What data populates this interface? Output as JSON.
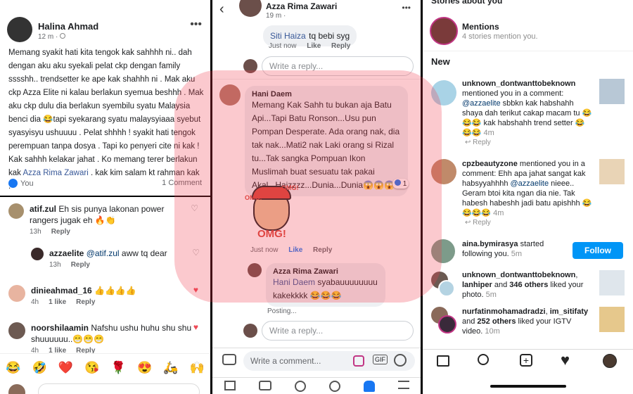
{
  "panel1": {
    "post": {
      "author": "Halina Ahmad",
      "time": "12 m",
      "body": "Memang syakit hati kita tengok kak sahhhh ni.. dah dengan aku aku syekali pelat ckp dengan family sssshh.. trendsetter ke ape kak shahhh ni . Mak aku ckp Azza Elite ni kalau berlakun syemua beshhh . Mak aku ckp dulu dia berlakun syembilu syatu Malaysia benci dia 😂tapi syekarang syatu malaysyiaaa syebut syasyisyu ushuuuu . Pelat shhhh ! syakit hati tengok perempuan tanpa dosya . Tapi ko penyeri cite ni kak ! Kak sahhh kelakar jahat . Ko memang terer berlakun kak",
      "mention": "Azza Rima Zawari",
      "body_end": ". kak kim salam kt rahman kak .",
      "reactors": "You",
      "comment_count": "1 Comment"
    },
    "comments": [
      {
        "name": "atif.zul",
        "text": "Eh sis punya lakonan power rangers jugak eh 🔥👏",
        "time": "13h",
        "reply": "Reply",
        "likes": ""
      },
      {
        "name": "azzaelite",
        "mention": "@atif.zul",
        "text": "aww tq dear",
        "time": "13h",
        "reply": "Reply",
        "likes": ""
      },
      {
        "name": "dinieahmad_16",
        "text": "👍👍👍👍",
        "time": "4h",
        "reply": "Reply",
        "likes": "1 like"
      },
      {
        "name": "noorshilaamin",
        "text": "Nafshu ushu huhu shu shu shuuuuuu..😁😁😁",
        "time": "4h",
        "reply": "Reply",
        "likes": "1 like"
      }
    ],
    "emoji_bar": [
      "😂",
      "🤣",
      "❤️",
      "😘",
      "🌹",
      "😍",
      "🛵",
      "🙌"
    ]
  },
  "panel2": {
    "header": {
      "name": "Azza Rima Zawari",
      "time": "19 m ·"
    },
    "top_reply": {
      "name": "Siti Haiza",
      "text": "tq bebi syg",
      "time": "Just now",
      "like": "Like",
      "reply": "Reply"
    },
    "reply_placeholder": "Write a reply...",
    "comment": {
      "name": "Hani Daem",
      "text": "Memang Kak Sahh tu bukan aja Batu Api...Tapi Batu Ronson...Usu pun Pompan Desperate. Ada orang nak, dia tak nak...Mati2 nak Laki orang si Rizal tu...Tak sangka Pompuan Ikon Muslimah buat sesuatu tak pakai Akal...Haizzzz...Dunia...Dunia😱😱😱",
      "reaction_count": "1",
      "sticker_text": "OMG!",
      "time": "Just now",
      "like": "Like",
      "reply": "Reply"
    },
    "nested_reply": {
      "name": "Azza Rima Zawari",
      "mention": "Hani Daem",
      "text": "syabauuuuuuuu kakekkkk 😂😂😂",
      "status": "Posting..."
    },
    "reply_placeholder2": "Write a reply...",
    "comment_placeholder": "Write a comment...",
    "gif": "GIF"
  },
  "panel3": {
    "stories_header": "Stories about you",
    "mentions_title": "Mentions",
    "mentions_sub": "4 stories mention you.",
    "section_new": "New",
    "activities": [
      {
        "user": "unknown_dontwanttobeknown",
        "text": "mentioned you in a comment:",
        "mention": "@azzaelite",
        "text2": "sbbkn kak habshahh shaya dah terikut cakap macam tu 😂😂😂 kak habshahh trend setter 😂😂😂",
        "time": "4m",
        "reply": "Reply"
      },
      {
        "user": "cpzbeautyzone",
        "text": "mentioned you in a comment: Ehh apa jahat sangat kak habsyyahhhh",
        "mention": "@azzaelite",
        "text2": "nieee.. Geram btoi kita ngan dia nie. Tak habesh habeshh jadi batu apishhh 😂😂😂😂",
        "time": "4m",
        "reply": "Reply"
      },
      {
        "user": "aina.bymirasya",
        "text": "started following you.",
        "time": "5m",
        "button": "Follow"
      },
      {
        "user": "unknown_dontwanttobeknown",
        "text": ",",
        "user2": "lanhiper",
        "text2": "and",
        "count": "346 others",
        "text3": "liked your photo.",
        "time": "5m"
      },
      {
        "user": "nurfatinmohamadradzi",
        "text": ",",
        "user2": "im_sitifaty",
        "text2": "and",
        "count": "252 others",
        "text3": "liked your IGTV video.",
        "time": "10m"
      }
    ]
  },
  "colors": {
    "fb_link": "#385898",
    "ig_blue": "#0095f6",
    "heart_red": "#ed4956",
    "watermark": "#f03c50"
  }
}
